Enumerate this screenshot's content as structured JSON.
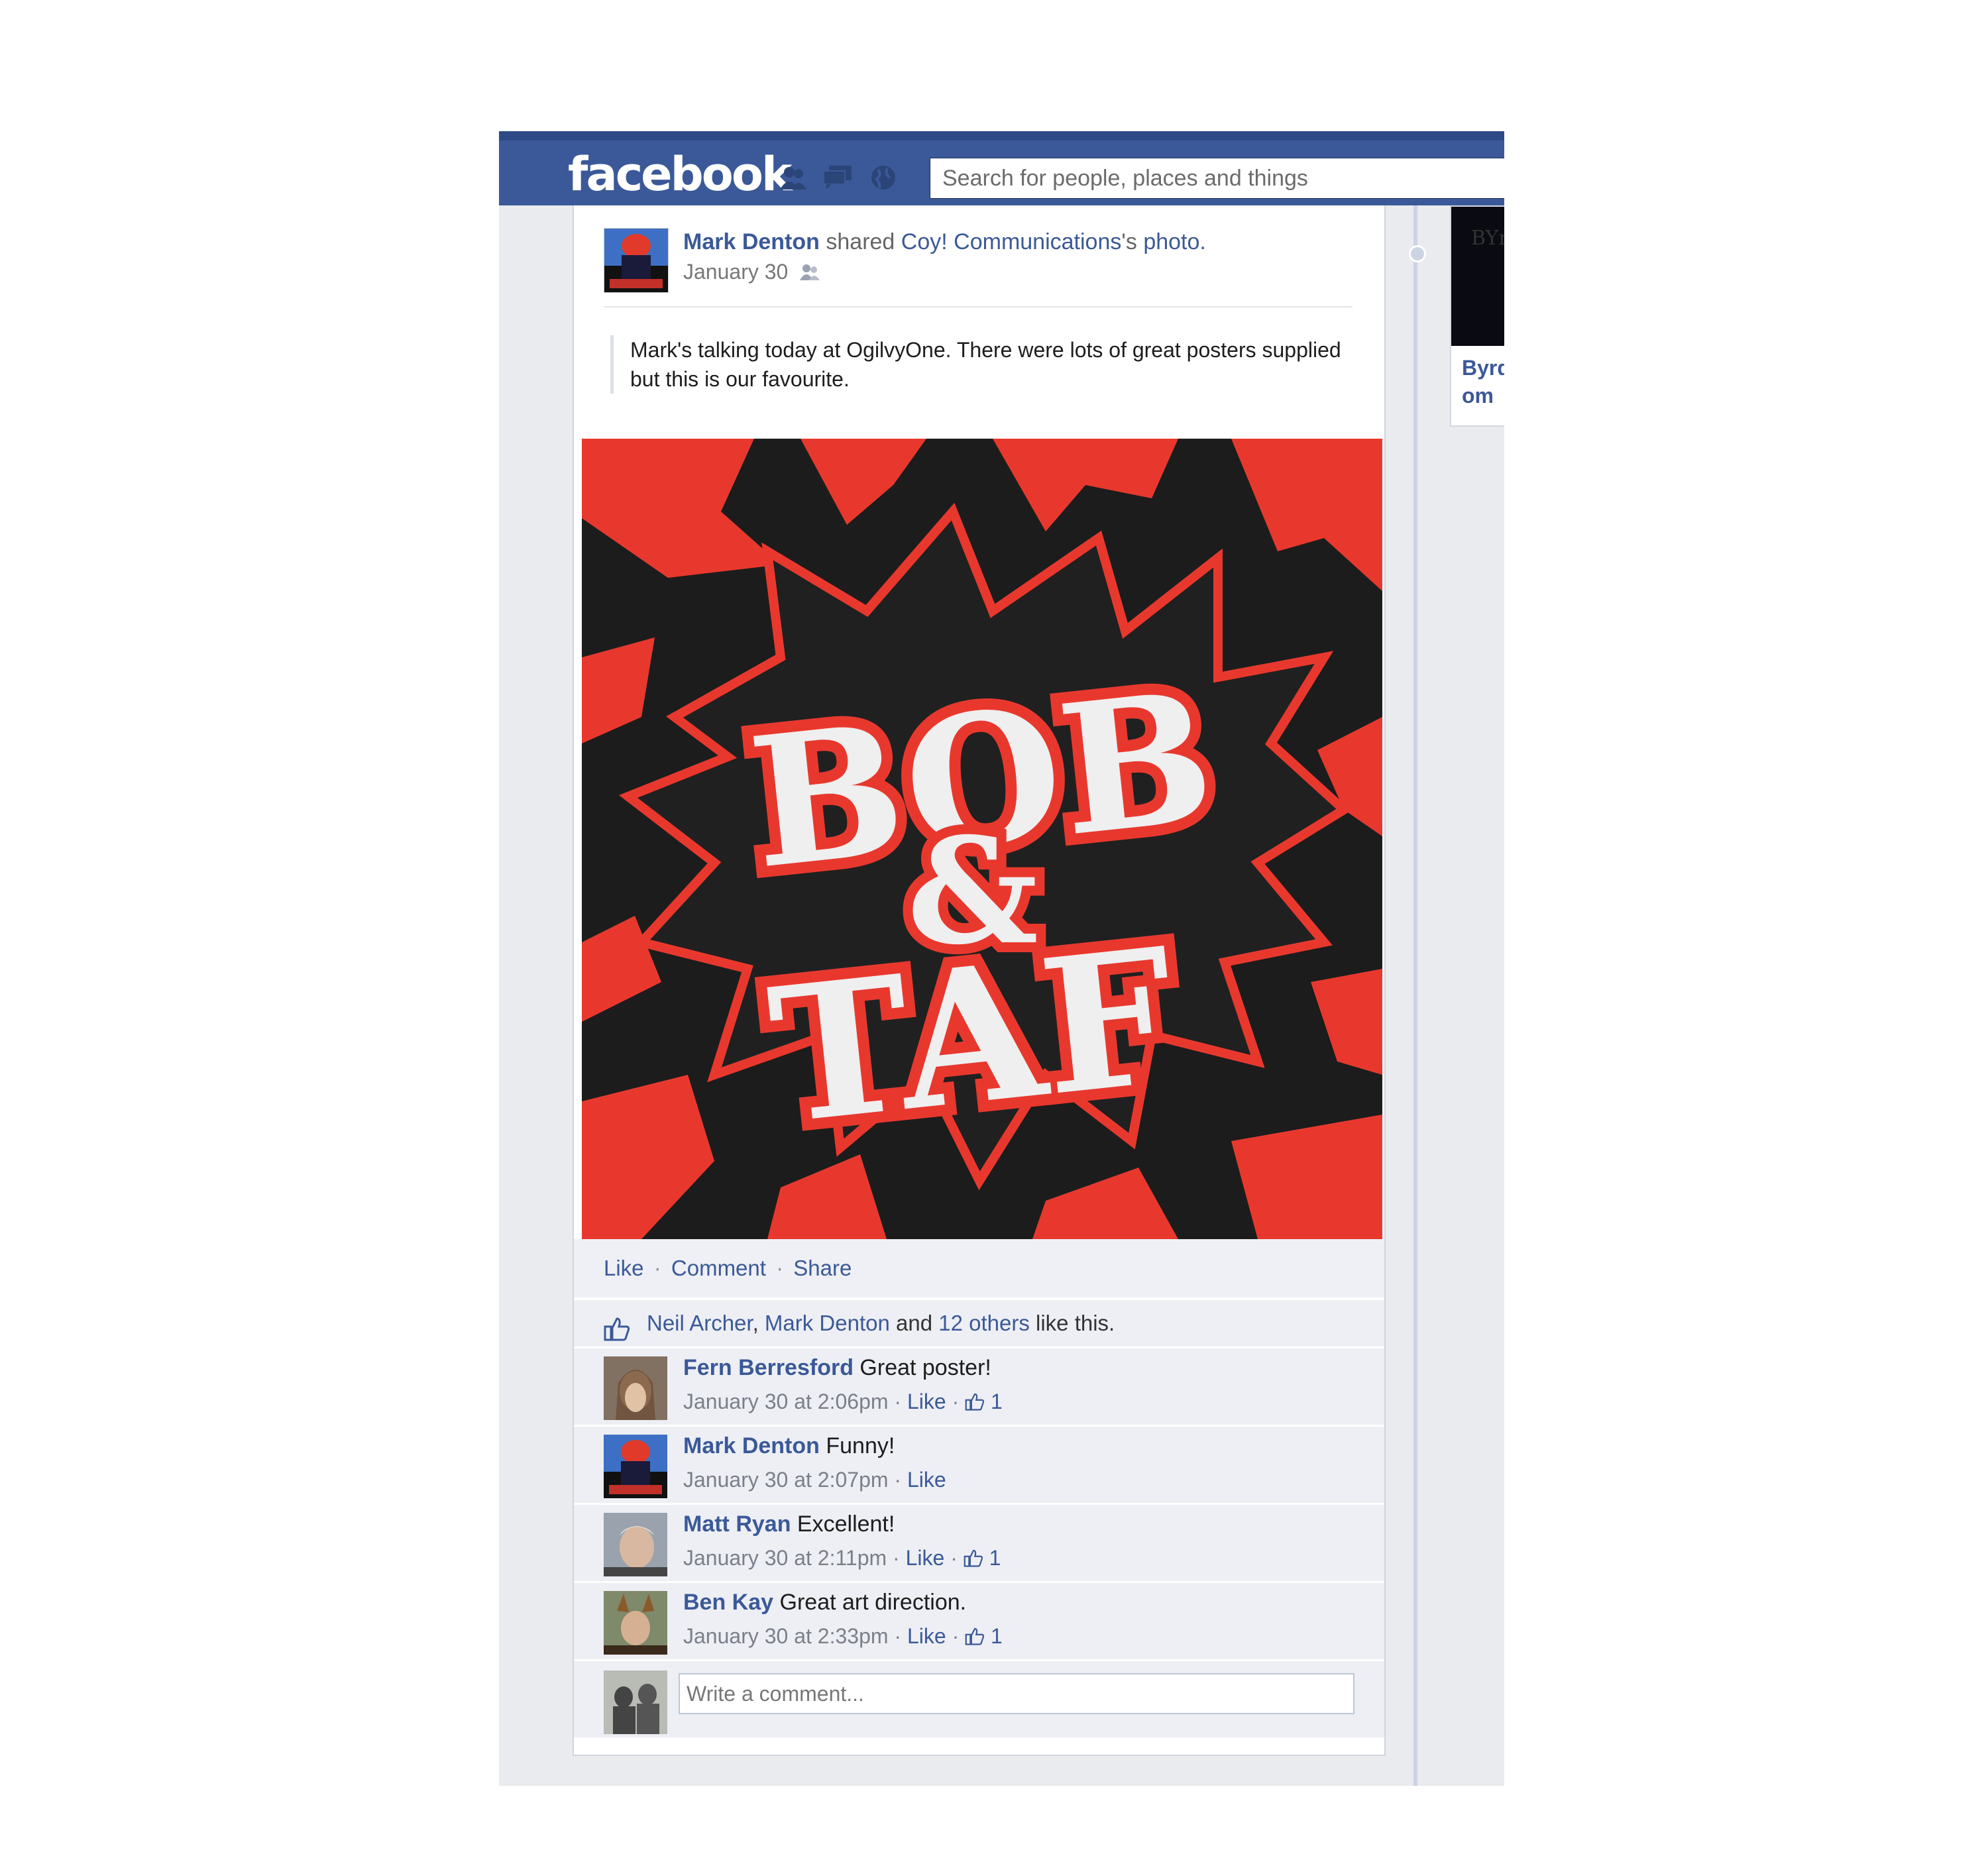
{
  "topbar": {
    "logo": "facebook",
    "search_placeholder": "Search for people, places and things",
    "icons": [
      "friend-requests-icon",
      "messages-icon",
      "notifications-globe-icon"
    ],
    "color": "#3b5998"
  },
  "post": {
    "author": "Mark Denton",
    "shared_text": "shared",
    "source_page": "Coy! Communications",
    "source_suffix": "'s",
    "object": "photo.",
    "date": "January 30",
    "audience_icon": "friends-audience-icon",
    "message": "Mark's talking today at OgilvyOne. There were lots of great posters supplied but this is our favourite.",
    "poster": {
      "line1": "BOB",
      "line2": "&",
      "line3": "TAF",
      "colors": {
        "red": "#e8382e",
        "dark": "#1c1c1c",
        "white": "#efefef"
      }
    },
    "actions": {
      "like": "Like",
      "comment": "Comment",
      "share": "Share"
    },
    "likes": {
      "person1": "Neil Archer",
      "comma": ",",
      "person2": "Mark Denton",
      "and": "and",
      "others": "12 others",
      "suffix": "like this."
    },
    "comments": [
      {
        "name": "Fern Berresford",
        "text": "Great poster!",
        "time": "January 30 at 2:06pm",
        "like": "Like",
        "count": "1"
      },
      {
        "name": "Mark Denton",
        "text": "Funny!",
        "time": "January 30 at 2:07pm",
        "like": "Like",
        "count": ""
      },
      {
        "name": "Matt Ryan",
        "text": "Excellent!",
        "time": "January 30 at 2:11pm",
        "like": "Like",
        "count": "1"
      },
      {
        "name": "Ben Kay",
        "text": "Great art direction.",
        "time": "January 30 at 2:33pm",
        "like": "Like",
        "count": "1"
      }
    ],
    "write_placeholder": "Write a comment..."
  },
  "right_card": {
    "thumb_text": "BYr",
    "name": "Byrd om"
  },
  "separator": "·"
}
